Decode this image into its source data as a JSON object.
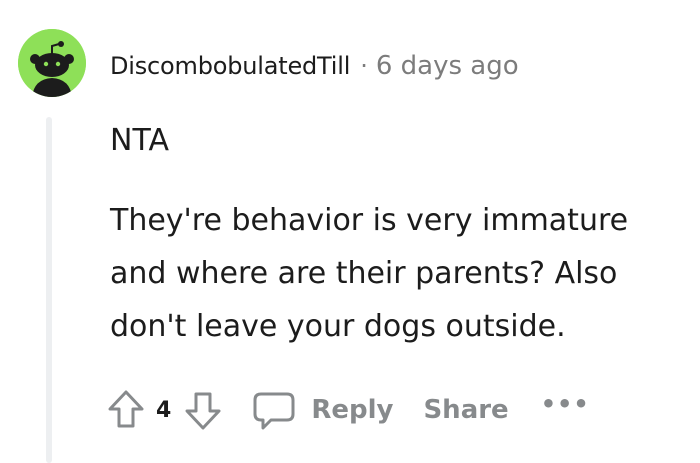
{
  "comment": {
    "username": "DiscombobulatedTill",
    "separator": "·",
    "timestamp": "6 days ago",
    "body": [
      "NTA",
      "They're behavior is very immature and where are their parents? Also don't leave your dogs outside."
    ],
    "avatar_color": "#8ee058",
    "avatar_icon": "snoo-icon"
  },
  "actions": {
    "upvote_icon": "upvote-arrow-icon",
    "vote_count": "4",
    "downvote_icon": "downvote-arrow-icon",
    "reply_icon": "speech-bubble-icon",
    "reply_label": "Reply",
    "share_label": "Share",
    "more_label": "•••"
  }
}
